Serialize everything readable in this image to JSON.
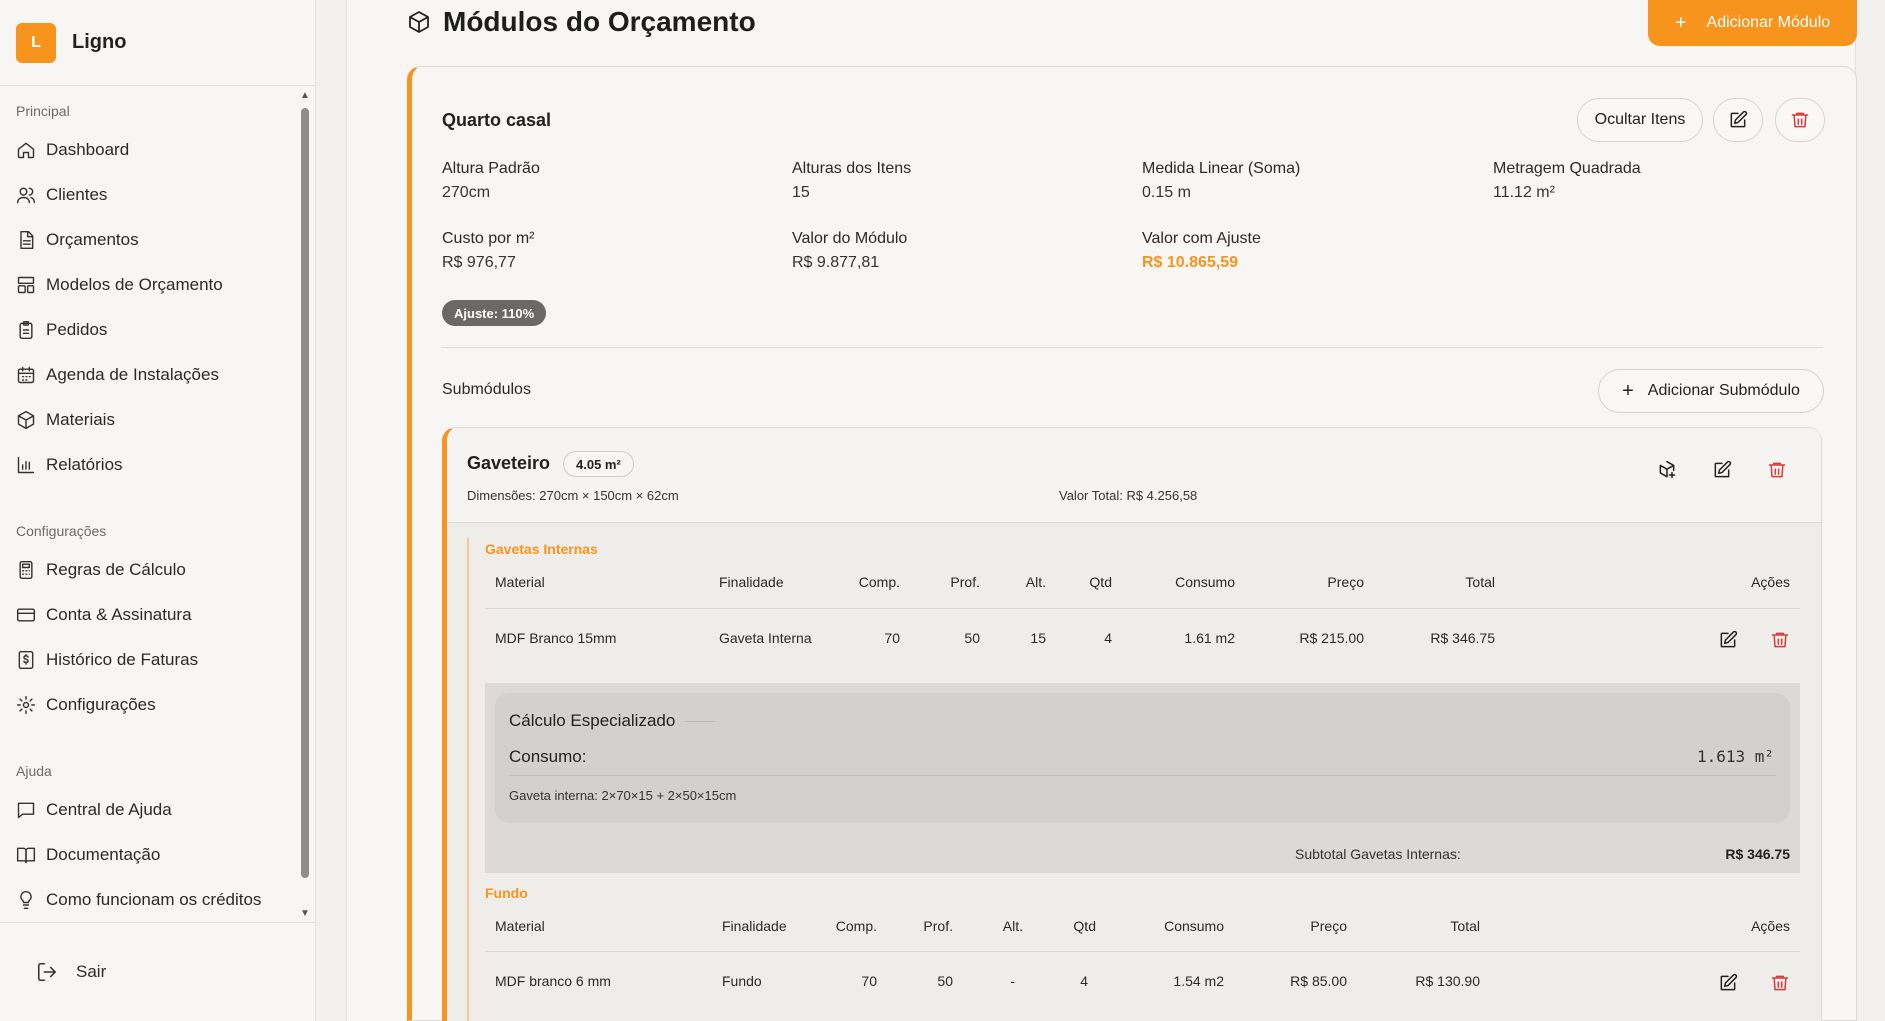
{
  "brand": {
    "logo_letter": "L",
    "name": "Ligno",
    "accent": "#f7941d"
  },
  "sidebar": {
    "sections": [
      {
        "title": "Principal",
        "items": [
          "Dashboard",
          "Clientes",
          "Orçamentos",
          "Modelos de Orçamento",
          "Pedidos",
          "Agenda de Instalações",
          "Materiais",
          "Relatórios"
        ]
      },
      {
        "title": "Configurações",
        "items": [
          "Regras de Cálculo",
          "Conta & Assinatura",
          "Histórico de Faturas",
          "Configurações"
        ]
      },
      {
        "title": "Ajuda",
        "items": [
          "Central de Ajuda",
          "Documentação",
          "Como funcionam os créditos"
        ]
      }
    ],
    "logout": "Sair"
  },
  "page": {
    "title": "Módulos do Orçamento",
    "add_module": "Adicionar Módulo"
  },
  "module": {
    "name": "Quarto casal",
    "hide_items": "Ocultar Itens",
    "stats": {
      "altura_padrao_label": "Altura Padrão",
      "altura_padrao": "270cm",
      "alturas_itens_label": "Alturas dos Itens",
      "alturas_itens": "15",
      "medida_linear_label": "Medida Linear (Soma)",
      "medida_linear": "0.15 m",
      "metragem_label": "Metragem Quadrada",
      "metragem": "11.12 m²",
      "custo_m2_label": "Custo por m²",
      "custo_m2": "R$ 976,77",
      "valor_modulo_label": "Valor do Módulo",
      "valor_modulo": "R$ 9.877,81",
      "valor_ajuste_label": "Valor com Ajuste",
      "valor_ajuste": "R$ 10.865,59"
    },
    "ajuste_badge": "Ajuste: 110%",
    "submodules_heading": "Submódulos",
    "add_submodule": "Adicionar Submódulo"
  },
  "submodule": {
    "name": "Gaveteiro",
    "area_chip": "4.05 m²",
    "dimensions": "Dimensões:  270cm × 150cm × 62cm",
    "total": "Valor Total:  R$ 4.256,58"
  },
  "table_headers": [
    "Material",
    "Finalidade",
    "Comp.",
    "Prof.",
    "Alt.",
    "Qtd",
    "Consumo",
    "Preço",
    "Total",
    "Ações"
  ],
  "groups": [
    {
      "title": "Gavetas Internas",
      "rows": [
        {
          "material": "MDF Branco 15mm",
          "finalidade": "Gaveta Interna",
          "comp": "70",
          "prof": "50",
          "alt": "15",
          "qtd": "4",
          "consumo": "1.61 m2",
          "preco": "R$ 215.00",
          "total": "R$ 346.75"
        }
      ],
      "calc": {
        "title": "Cálculo Especializado",
        "label": "Consumo:",
        "value": "1.613 m²",
        "formula": "Gaveta interna: 2×70×15 + 2×50×15cm"
      },
      "subtotal_label": "Subtotal Gavetas Internas:",
      "subtotal_value": "R$ 346.75"
    },
    {
      "title": "Fundo",
      "rows": [
        {
          "material": "MDF branco 6 mm",
          "finalidade": "Fundo",
          "comp": "70",
          "prof": "50",
          "alt": "-",
          "qtd": "4",
          "consumo": "1.54 m2",
          "preco": "R$ 85.00",
          "total": "R$ 130.90"
        }
      ]
    }
  ]
}
